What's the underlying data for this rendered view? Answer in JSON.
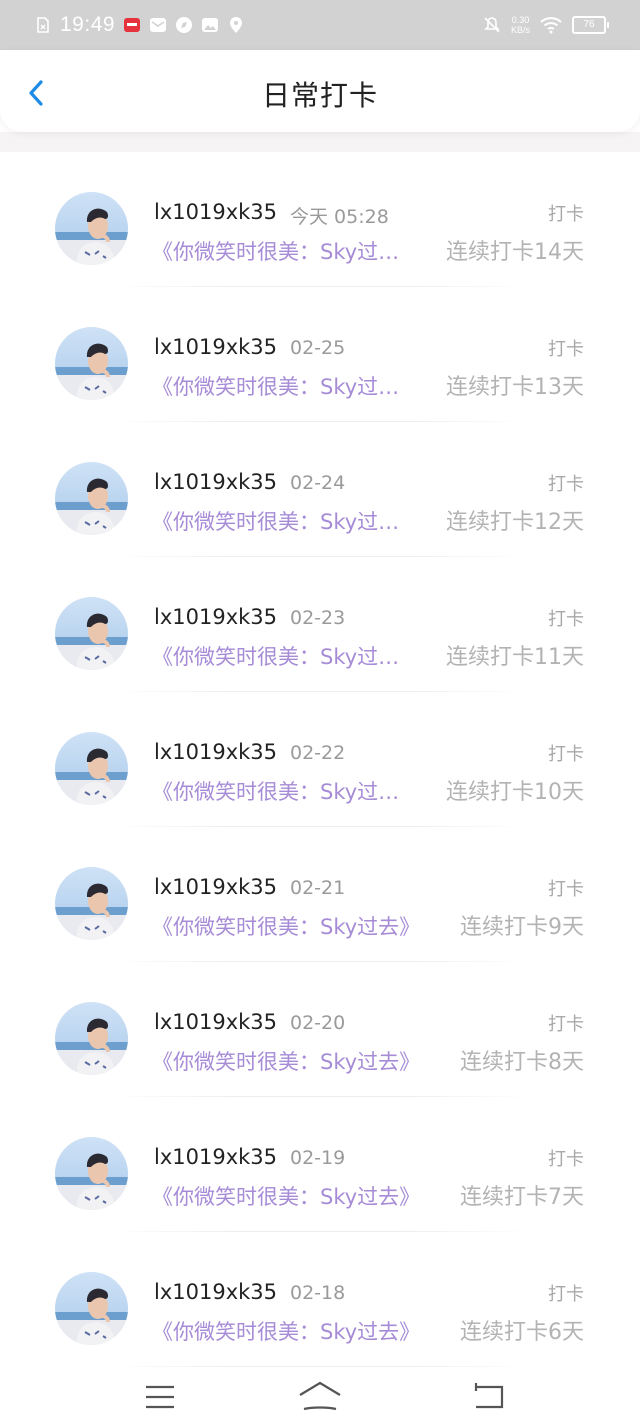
{
  "status_bar": {
    "time": "19:49",
    "net_speed_value": "0.30",
    "net_speed_unit": "KB/s",
    "battery": "76"
  },
  "header": {
    "title": "日常打卡"
  },
  "items": [
    {
      "username": "lx1019xk35",
      "time": "今天 05:28",
      "tag": "打卡",
      "book": "《你微笑时很美：Sky过…",
      "streak": "连续打卡14天"
    },
    {
      "username": "lx1019xk35",
      "time": "02-25",
      "tag": "打卡",
      "book": "《你微笑时很美：Sky过…",
      "streak": "连续打卡13天"
    },
    {
      "username": "lx1019xk35",
      "time": "02-24",
      "tag": "打卡",
      "book": "《你微笑时很美：Sky过…",
      "streak": "连续打卡12天"
    },
    {
      "username": "lx1019xk35",
      "time": "02-23",
      "tag": "打卡",
      "book": "《你微笑时很美：Sky过…",
      "streak": "连续打卡11天"
    },
    {
      "username": "lx1019xk35",
      "time": "02-22",
      "tag": "打卡",
      "book": "《你微笑时很美：Sky过…",
      "streak": "连续打卡10天"
    },
    {
      "username": "lx1019xk35",
      "time": "02-21",
      "tag": "打卡",
      "book": "《你微笑时很美：Sky过去》",
      "streak": "连续打卡9天"
    },
    {
      "username": "lx1019xk35",
      "time": "02-20",
      "tag": "打卡",
      "book": "《你微笑时很美：Sky过去》",
      "streak": "连续打卡8天"
    },
    {
      "username": "lx1019xk35",
      "time": "02-19",
      "tag": "打卡",
      "book": "《你微笑时很美：Sky过去》",
      "streak": "连续打卡7天"
    },
    {
      "username": "lx1019xk35",
      "time": "02-18",
      "tag": "打卡",
      "book": "《你微笑时很美：Sky过去》",
      "streak": "连续打卡6天"
    }
  ],
  "colors": {
    "accent": "#1e8be6",
    "book_title": "#a68bd6",
    "status_bar_bg": "#d2d2d2"
  },
  "icons": {
    "back": "chevron-left-icon",
    "nav_menu": "menu-icon",
    "nav_home": "home-icon",
    "nav_back": "return-icon"
  }
}
